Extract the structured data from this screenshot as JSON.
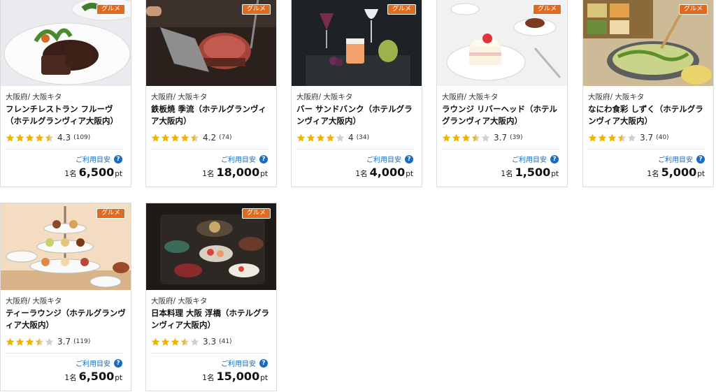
{
  "colors": {
    "tag_bg": "#e06a1d",
    "star_full": "#f0b400",
    "star_empty": "#d0d0d0",
    "link": "#1a6cbf"
  },
  "cards": [
    {
      "tag": "グルメ",
      "location": "大阪府/ 大阪キタ",
      "name": "フレンチレストラン フルーヴ（ホテルグランヴィア大阪内）",
      "rating": 4.3,
      "rating_text": "4.3",
      "reviews": "(109)",
      "guide": "ご利用目安",
      "per": "1名",
      "price": "6,500",
      "unit": "pt",
      "image": "french-steak-plate"
    },
    {
      "tag": "グルメ",
      "location": "大阪府/ 大阪キタ",
      "name": "鉄板焼 季流（ホテルグランヴィア大阪内）",
      "rating": 4.2,
      "rating_text": "4.2",
      "reviews": "(74)",
      "guide": "ご利用目安",
      "per": "1名",
      "price": "18,000",
      "unit": "pt",
      "image": "teppanyaki-beef"
    },
    {
      "tag": "グルメ",
      "location": "大阪府/ 大阪キタ",
      "name": "バー サンドバンク（ホテルグランヴィア大阪内）",
      "rating": 4,
      "rating_text": "4",
      "reviews": "(34)",
      "guide": "ご利用目安",
      "per": "1名",
      "price": "4,000",
      "unit": "pt",
      "image": "bar-cocktails"
    },
    {
      "tag": "グルメ",
      "location": "大阪府/ 大阪キタ",
      "name": "ラウンジ リバーヘッド（ホテルグランヴィア大阪内）",
      "rating": 3.7,
      "rating_text": "3.7",
      "reviews": "(39)",
      "guide": "ご利用目安",
      "per": "1名",
      "price": "1,500",
      "unit": "pt",
      "image": "shortcake-tea"
    },
    {
      "tag": "グルメ",
      "location": "大阪府/ 大阪キタ",
      "name": "なにわ食彩 しずく（ホテルグランヴィア大阪内）",
      "rating": 3.7,
      "rating_text": "3.7",
      "reviews": "(40)",
      "guide": "ご利用目安",
      "per": "1名",
      "price": "5,000",
      "unit": "pt",
      "image": "bento-hotpot"
    },
    {
      "tag": "グルメ",
      "location": "大阪府/ 大阪キタ",
      "name": "ティーラウンジ（ホテルグランヴィア大阪内）",
      "rating": 3.7,
      "rating_text": "3.7",
      "reviews": "(119)",
      "guide": "ご利用目安",
      "per": "1名",
      "price": "6,500",
      "unit": "pt",
      "image": "afternoon-tea-stand"
    },
    {
      "tag": "グルメ",
      "location": "大阪府/ 大阪キタ",
      "name": "日本料理 大阪 浮橋（ホテルグランヴィア大阪内）",
      "rating": 3.3,
      "rating_text": "3.3",
      "reviews": "(41)",
      "guide": "ご利用目安",
      "per": "1名",
      "price": "15,000",
      "unit": "pt",
      "image": "japanese-kaiseki"
    }
  ]
}
